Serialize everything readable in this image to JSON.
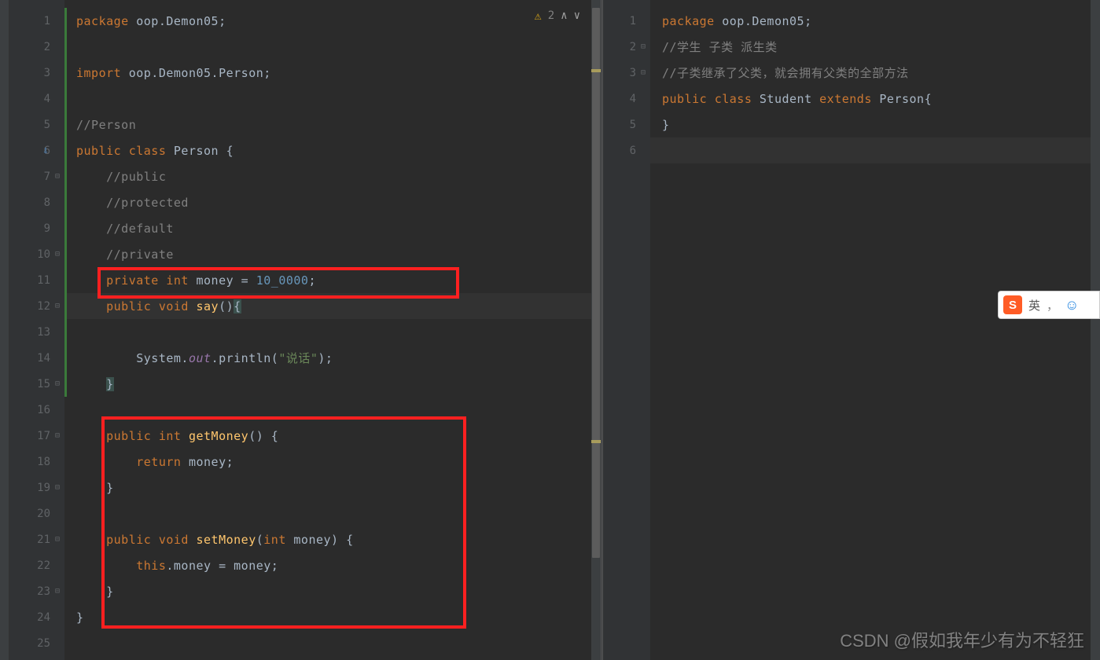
{
  "leftGutter": [
    "1",
    "2",
    "3",
    "4",
    "5",
    "6",
    "7",
    "8",
    "9",
    "10",
    "11",
    "12",
    "13",
    "14",
    "15",
    "16",
    "17",
    "18",
    "19",
    "20",
    "21",
    "22",
    "23",
    "24",
    "25"
  ],
  "rightGutter": [
    "1",
    "2",
    "3",
    "4",
    "5",
    "6"
  ],
  "warnings": {
    "count": "2"
  },
  "leftCode": {
    "l1": {
      "kw": "package",
      "a": " oop.Demon05;"
    },
    "l3": {
      "kw": "import",
      "a": " oop.Demon05.Person;"
    },
    "l5": "//Person",
    "l6": {
      "kw": "public class",
      "a": " Person {"
    },
    "l7": "    //public",
    "l8": "    //protected",
    "l9": "    //default",
    "l10": "    //private",
    "l11": {
      "pre": "    ",
      "kw1": "private int",
      "a": " money = ",
      "num": "10_0000",
      "b": ";"
    },
    "l12": {
      "pre": "    ",
      "kw1": "public void",
      "a": " ",
      "mth": "say",
      "b": "()",
      "br": "{"
    },
    "l14": {
      "pre": "        System.",
      "fld": "out",
      "a": ".println(",
      "str": "\"说话\"",
      "b": ");"
    },
    "l15": {
      "pre": "    ",
      "br": "}"
    },
    "l17": {
      "pre": "    ",
      "kw1": "public int",
      "a": " ",
      "mth": "getMoney",
      "b": "() {"
    },
    "l18": {
      "pre": "        ",
      "kw": "return",
      "a": " money;"
    },
    "l19": "    }",
    "l21": {
      "pre": "    ",
      "kw1": "public void",
      "a": " ",
      "mth": "setMoney",
      "b": "(",
      "kw2": "int",
      "c": " money) {"
    },
    "l22": {
      "pre": "        ",
      "kw": "this",
      "a": ".money = money;"
    },
    "l23": "    }",
    "l24": "}"
  },
  "rightCode": {
    "l1": {
      "kw": "package",
      "a": " oop.Demon05;"
    },
    "l2": "//学生 子类 派生类",
    "l3": "//子类继承了父类，就会拥有父类的全部方法",
    "l4": {
      "kw1": "public class",
      "a": " Student ",
      "kw2": "extends",
      "b": " Person{"
    },
    "l5": "}"
  },
  "ime": {
    "logo": "S",
    "lang": "英",
    "comma": "，"
  },
  "watermark": "CSDN @假如我年少有为不轻狂"
}
